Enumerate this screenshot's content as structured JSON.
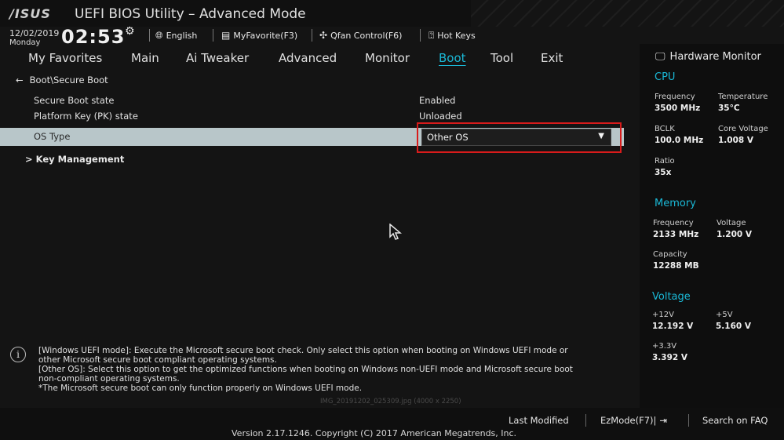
{
  "window": {
    "logo": "/ISUS",
    "title": "UEFI BIOS Utility – Advanced Mode"
  },
  "status": {
    "date": "12/02/2019",
    "day": "Monday",
    "time": "02:53"
  },
  "toolbar": {
    "language": "English",
    "favorite": "MyFavorite(F3)",
    "qfan": "Qfan Control(F6)",
    "hotkeys": "Hot Keys"
  },
  "menu": {
    "items": [
      "My Favorites",
      "Main",
      "Ai Tweaker",
      "Advanced",
      "Monitor",
      "Boot",
      "Tool",
      "Exit"
    ],
    "active_index": 5
  },
  "main": {
    "breadcrumb": "Boot\\Secure Boot",
    "rows": [
      {
        "label": "Secure Boot state",
        "value": "Enabled"
      },
      {
        "label": "Platform Key (PK) state",
        "value": "Unloaded"
      }
    ],
    "os_type": {
      "label": "OS Type",
      "value": "Other OS"
    },
    "submenu": "Key Management"
  },
  "help": {
    "lines": [
      "[Windows UEFI mode]: Execute the Microsoft secure boot check. Only select this option when booting on Windows UEFI mode or",
      "other Microsoft secure boot compliant operating systems.",
      "[Other OS]: Select this option to get the optimized functions when booting on Windows non-UEFI mode and Microsoft secure boot",
      "non-compliant operating systems.",
      "*The Microsoft secure boot can only function properly on Windows UEFI mode."
    ],
    "watermark": "IMG_20191202_025309.jpg (4000 x 2250)"
  },
  "bottom": {
    "last_modified": "Last Modified",
    "ezmode": "EzMode(F7)|",
    "search": "Search on FAQ",
    "version": "Version 2.17.1246. Copyright (C) 2017 American Megatrends, Inc."
  },
  "hardware_monitor": {
    "title": "Hardware Monitor",
    "cpu": {
      "heading": "CPU",
      "frequency_label": "Frequency",
      "frequency": "3500 MHz",
      "temperature_label": "Temperature",
      "temperature": "35°C",
      "bclk_label": "BCLK",
      "bclk": "100.0 MHz",
      "core_voltage_label": "Core Voltage",
      "core_voltage": "1.008 V",
      "ratio_label": "Ratio",
      "ratio": "35x"
    },
    "memory": {
      "heading": "Memory",
      "frequency_label": "Frequency",
      "frequency": "2133 MHz",
      "voltage_label": "Voltage",
      "voltage": "1.200 V",
      "capacity_label": "Capacity",
      "capacity": "12288 MB"
    },
    "voltage": {
      "heading": "Voltage",
      "v12_label": "+12V",
      "v12": "12.192 V",
      "v5_label": "+5V",
      "v5": "5.160 V",
      "v33_label": "+3.3V",
      "v33": "3.392 V"
    }
  },
  "colors": {
    "accent": "#1ab8d6",
    "highlight_row": "#b8c6c9",
    "annotation_box": "#d81b1b"
  }
}
